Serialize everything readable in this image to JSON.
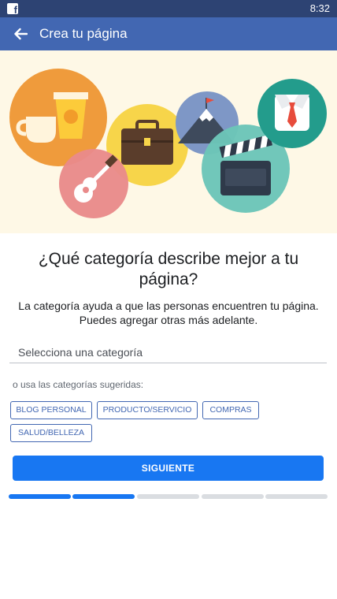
{
  "status_bar": {
    "time": "8:32",
    "app_icon": "facebook-icon"
  },
  "app_bar": {
    "back_icon": "arrow-left-icon",
    "title": "Crea tu página"
  },
  "hero": {
    "icons": [
      "coffee-icon",
      "briefcase-icon",
      "mountain-flag-icon",
      "shirt-tie-icon",
      "guitar-icon",
      "clapperboard-icon"
    ]
  },
  "main": {
    "question": "¿Qué categoría describe mejor a tu página?",
    "subtitle": "La categoría ayuda a que las personas encuentren tu página. Puedes agregar otras más adelante.",
    "category_input": {
      "placeholder": "Selecciona una categoría",
      "value": ""
    },
    "suggested_label": "o usa las categorías sugeridas:",
    "chips": [
      "BLOG PERSONAL",
      "PRODUCTO/SERVICIO",
      "COMPRAS",
      "SALUD/BELLEZA"
    ],
    "next_label": "SIGUIENTE"
  },
  "progress": {
    "total_steps": 5,
    "completed_steps": 2
  },
  "colors": {
    "brand": "#4267b2",
    "status_bar": "#2d4373",
    "primary_button": "#1877f2",
    "hero_background": "#fef8e6"
  }
}
